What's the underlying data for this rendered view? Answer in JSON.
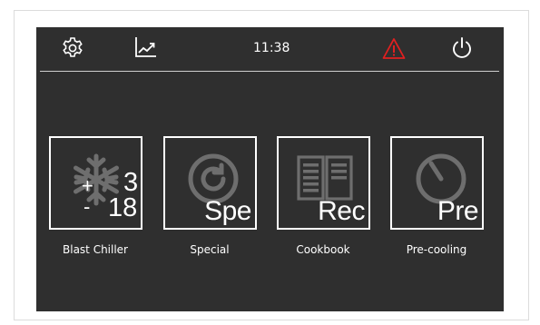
{
  "topbar": {
    "time": "11:38",
    "icons": [
      "gear-icon",
      "trend-chart-icon",
      "warning-triangle-icon",
      "power-icon"
    ],
    "warning_color": "#e02020"
  },
  "tiles": [
    {
      "label": "Blast Chiller",
      "icon": "snowflake-icon",
      "plus_sign": "+",
      "minus_sign": "-",
      "value_top": "3",
      "value_bottom": "18"
    },
    {
      "label": "Special",
      "icon": "cycle-icon",
      "code": "Spe"
    },
    {
      "label": "Cookbook",
      "icon": "book-icon",
      "code": "Rec"
    },
    {
      "label": "Pre-cooling",
      "icon": "clock-icon",
      "code": "Pre"
    }
  ],
  "colors": {
    "screen_bg": "#2f2f2f",
    "icon_gray": "#6e6e6e",
    "text": "#ffffff"
  }
}
